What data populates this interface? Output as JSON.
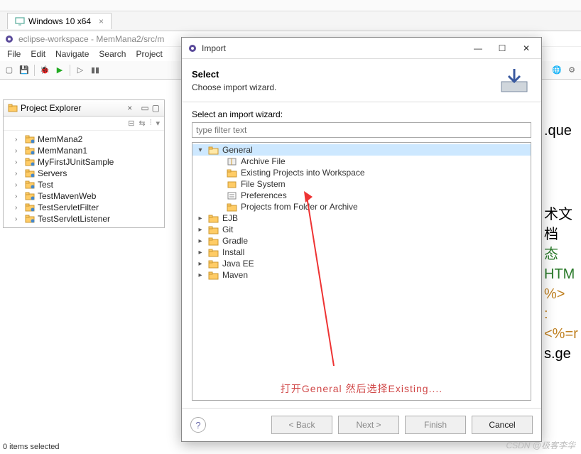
{
  "vm_tab": "Windows 10 x64",
  "eclipse": {
    "title": "eclipse-workspace - MemMana2/src/m",
    "menus": [
      "File",
      "Edit",
      "Navigate",
      "Search",
      "Project"
    ]
  },
  "project_explorer": {
    "title": "Project Explorer",
    "items": [
      "MemMana2",
      "MemManan1",
      "MyFirstJUnitSample",
      "Servers",
      "Test",
      "TestMavenWeb",
      "TestServletFilter",
      "TestServletListener"
    ]
  },
  "code": {
    "l1": ".que",
    "l2": "术文档",
    "l3": "态HTM",
    "l4": "%>",
    "l5": ":<%=r",
    "l6": "s.ge"
  },
  "dialog": {
    "title": "Import",
    "heading": "Select",
    "subheading": "Choose import wizard.",
    "label": "Select an import wizard:",
    "filter_placeholder": "type filter text",
    "tree": {
      "general": "General",
      "general_children": [
        "Archive File",
        "Existing Projects into Workspace",
        "File System",
        "Preferences",
        "Projects from Folder or Archive"
      ],
      "folders": [
        "EJB",
        "Git",
        "Gradle",
        "Install",
        "Java EE",
        "Maven"
      ]
    },
    "annotation": "打开General 然后选择Existing....",
    "buttons": {
      "back": "< Back",
      "next": "Next >",
      "finish": "Finish",
      "cancel": "Cancel"
    }
  },
  "statusbar": "0 items selected",
  "watermark": "CSDN @极客李华"
}
